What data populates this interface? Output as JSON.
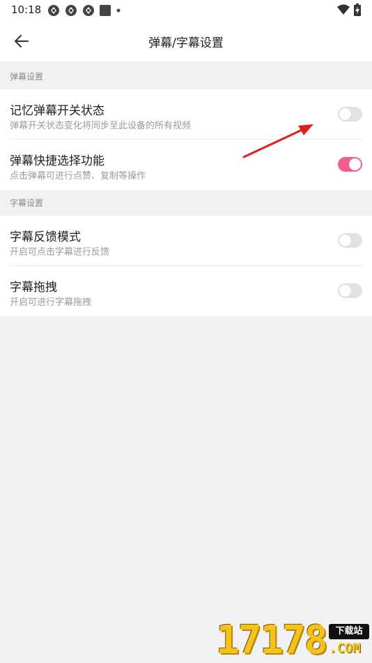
{
  "status_bar": {
    "time": "10:18",
    "notification_icons": [
      "app-icon",
      "app-icon",
      "app-icon",
      "square-icon",
      "dot-icon"
    ],
    "right_icons": [
      "wifi-icon",
      "battery-charging-icon"
    ]
  },
  "header": {
    "back_icon": "arrow-left-icon",
    "title": "弹幕/字幕设置"
  },
  "sections": [
    {
      "header": "弹幕设置",
      "items": [
        {
          "title": "记忆弹幕开关状态",
          "subtitle": "弹幕开关状态变化将同步至此设备的所有视频",
          "enabled": false
        },
        {
          "title": "弹幕快捷选择功能",
          "subtitle": "点击弹幕可进行点赞、复制等操作",
          "enabled": true
        }
      ]
    },
    {
      "header": "字幕设置",
      "items": [
        {
          "title": "字幕反馈模式",
          "subtitle": "开启可点击字幕进行反馈",
          "enabled": false
        },
        {
          "title": "字幕拖拽",
          "subtitle": "开启可进行字幕拖拽",
          "enabled": false
        }
      ]
    }
  ],
  "colors": {
    "accent": "#f15f8e",
    "background": "#f0f1f3",
    "annotation_arrow": "#e0201a"
  },
  "watermark": {
    "digits": "17178",
    "badge": "下载站",
    "domain": ".COM"
  }
}
